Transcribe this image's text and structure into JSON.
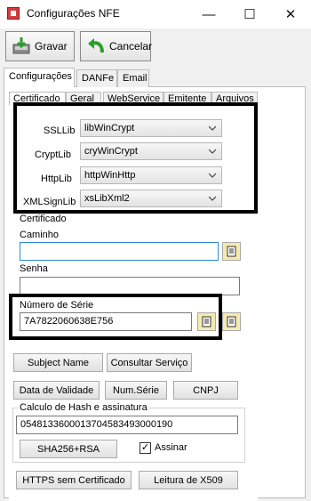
{
  "window": {
    "title": "Configurações NFE",
    "minimize": "—",
    "maximize": "☐",
    "close": "✕"
  },
  "toolbar": {
    "gravar": "Gravar",
    "cancelar": "Cancelar"
  },
  "tabs_top": [
    "Configurações",
    "DANFe",
    "Email"
  ],
  "tabs_inner": [
    "Certificado",
    "Geral",
    "WebService",
    "Emitente",
    "Arquivos"
  ],
  "libs": {
    "ssllib_label": "SSLLib",
    "ssllib_value": "libWinCrypt",
    "cryptlib_label": "CryptLib",
    "cryptlib_value": "cryWinCrypt",
    "httplib_label": "HttpLib",
    "httplib_value": "httpWinHttp",
    "xmlsignlib_label": "XMLSignLib",
    "xmlsignlib_value": "xsLibXml2"
  },
  "certificado": {
    "group_label": "Certificado",
    "caminho_label": "Caminho",
    "caminho_value": "",
    "senha_label": "Senha",
    "senha_value": "",
    "numero_serie_label": "Número de Série",
    "numero_serie_value": "7A7822060638E756"
  },
  "buttons": {
    "subject_name": "Subject Name",
    "consultar_servico": "Consultar Serviço",
    "data_validade": "Data de Validade",
    "num_serie": "Num.Série",
    "cnpj": "CNPJ",
    "sha256": "SHA256+RSA",
    "https_sem_cert": "HTTPS sem Certificado",
    "leitura_x509": "Leitura de X509"
  },
  "hash": {
    "group_label": "Calculo de Hash e assinatura",
    "value": "0548133600013704583493000190",
    "assinar_label": "Assinar",
    "assinar_checked": true
  }
}
